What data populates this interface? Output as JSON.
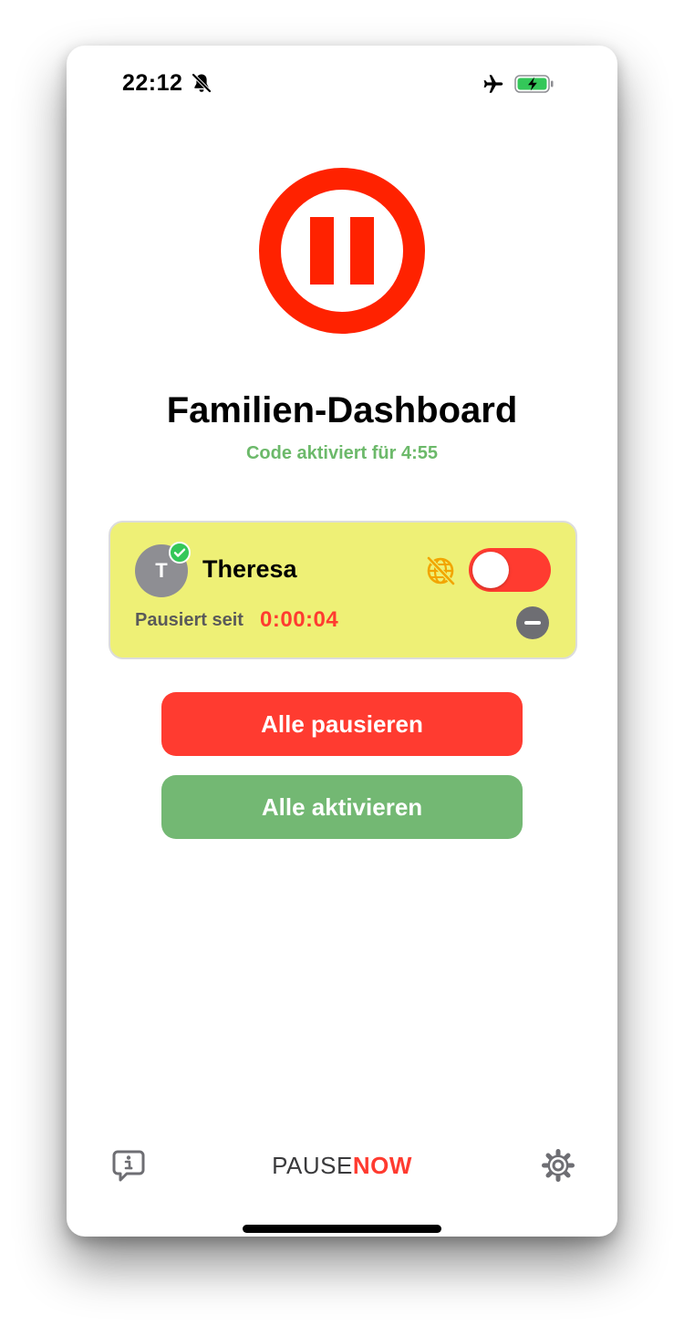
{
  "status_bar": {
    "time": "22:12",
    "icons": [
      "bell-slash-icon",
      "airplane-icon",
      "battery-charging-icon"
    ],
    "battery_color": "#34c759"
  },
  "header": {
    "logo_icon": "pause-circle-icon",
    "title": "Familien-Dashboard",
    "subtitle": "Code aktiviert für 4:55"
  },
  "members": [
    {
      "avatar_initial": "T",
      "name": "Theresa",
      "verified": true,
      "internet_blocked_icon": "globe-slash-icon",
      "toggle_on": false,
      "paused_label": "Pausiert seit",
      "paused_time": "0:00:04"
    }
  ],
  "actions": {
    "pause_all": "Alle pausieren",
    "activate_all": "Alle aktivieren"
  },
  "footer": {
    "brand_part1": "PAUSE",
    "brand_part2": "NOW",
    "left_icon": "info-bubble-icon",
    "right_icon": "gear-icon"
  },
  "colors": {
    "accent_red": "#ff3b30",
    "accent_green": "#73b873",
    "card_yellow": "#eef076",
    "subtitle_green": "#6cb96a"
  }
}
